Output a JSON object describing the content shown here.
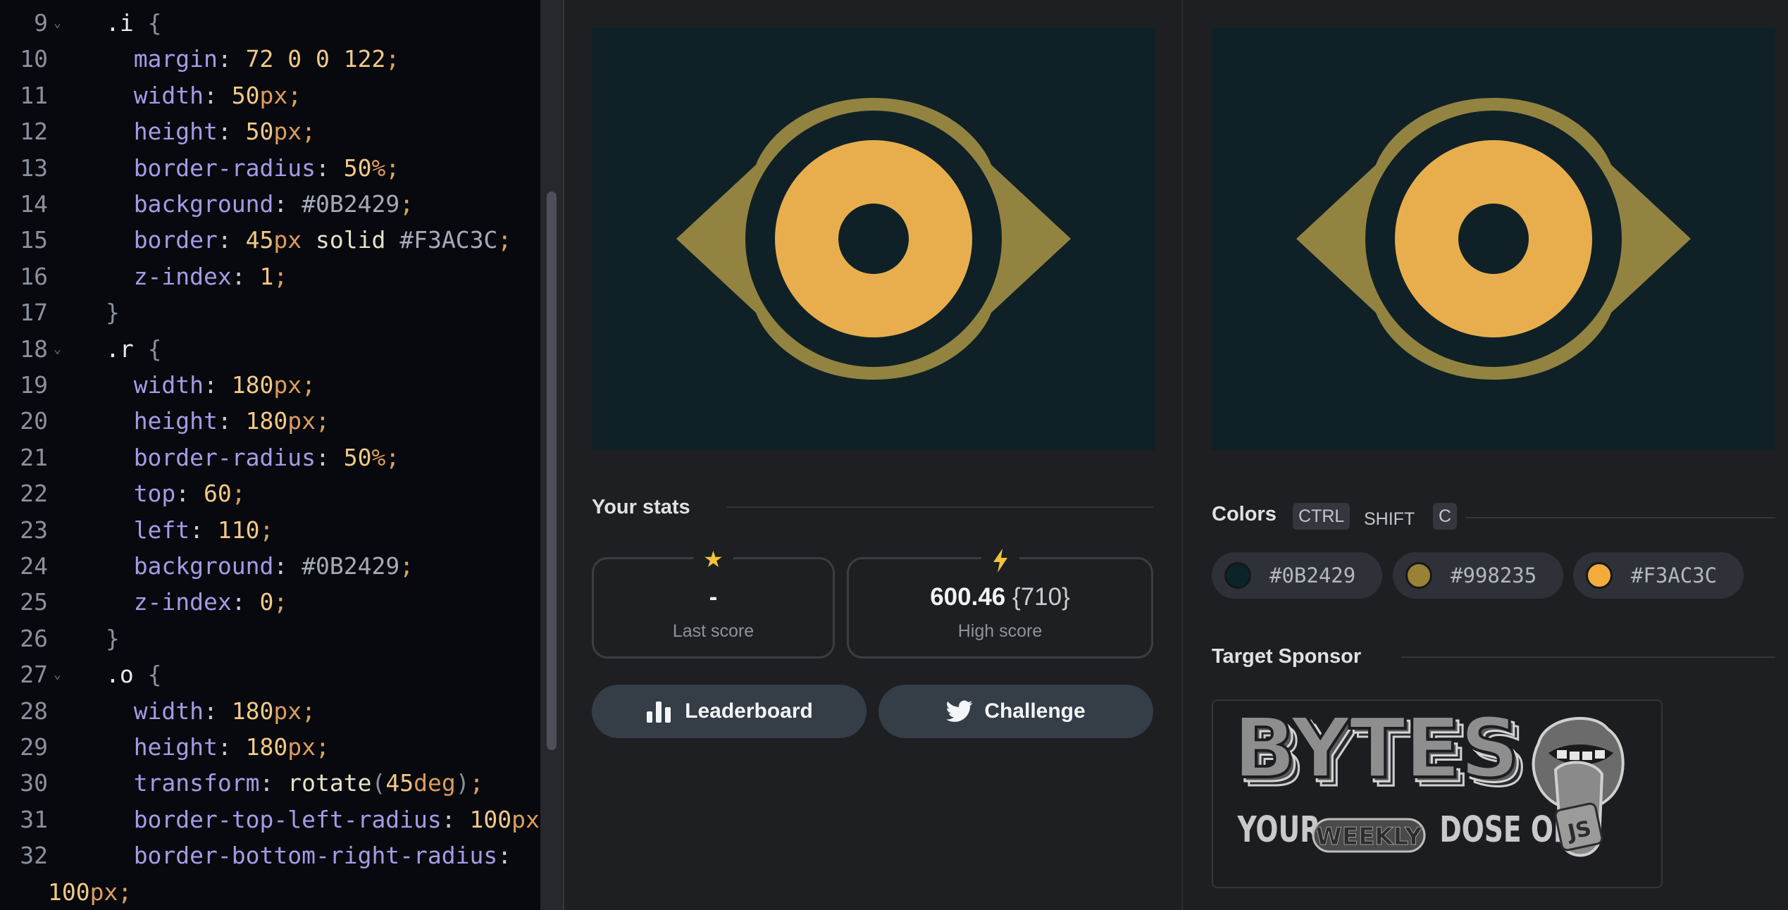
{
  "editor": {
    "lines": [
      {
        "num": "9",
        "fold": true,
        "indent": "  ",
        "tokens": [
          [
            ".i",
            "sel"
          ],
          [
            " ",
            ""
          ],
          [
            "{",
            "brace"
          ]
        ]
      },
      {
        "num": "10",
        "fold": false,
        "indent": "    ",
        "tokens": [
          [
            "margin",
            "prop"
          ],
          [
            ": ",
            ""
          ],
          [
            "72 0 0 122",
            "num"
          ],
          [
            ";",
            "punc"
          ]
        ]
      },
      {
        "num": "11",
        "fold": false,
        "indent": "    ",
        "tokens": [
          [
            "width",
            "prop"
          ],
          [
            ": ",
            ""
          ],
          [
            "50",
            "num"
          ],
          [
            "px",
            "unit"
          ],
          [
            ";",
            "punc"
          ]
        ]
      },
      {
        "num": "12",
        "fold": false,
        "indent": "    ",
        "tokens": [
          [
            "height",
            "prop"
          ],
          [
            ": ",
            ""
          ],
          [
            "50",
            "num"
          ],
          [
            "px",
            "unit"
          ],
          [
            ";",
            "punc"
          ]
        ]
      },
      {
        "num": "13",
        "fold": false,
        "indent": "    ",
        "tokens": [
          [
            "border-radius",
            "prop"
          ],
          [
            ": ",
            ""
          ],
          [
            "50",
            "num"
          ],
          [
            "%",
            "unit"
          ],
          [
            ";",
            "punc"
          ]
        ]
      },
      {
        "num": "14",
        "fold": false,
        "indent": "    ",
        "tokens": [
          [
            "background",
            "prop"
          ],
          [
            ": ",
            ""
          ],
          [
            "#0B2429",
            "hex"
          ],
          [
            ";",
            "punc"
          ]
        ]
      },
      {
        "num": "15",
        "fold": false,
        "indent": "    ",
        "tokens": [
          [
            "border",
            "prop"
          ],
          [
            ": ",
            ""
          ],
          [
            "45",
            "num"
          ],
          [
            "px",
            "unit"
          ],
          [
            " ",
            ""
          ],
          [
            "solid",
            "kw"
          ],
          [
            " ",
            ""
          ],
          [
            "#F3AC3C",
            "hex"
          ],
          [
            ";",
            "punc"
          ]
        ]
      },
      {
        "num": "16",
        "fold": false,
        "indent": "    ",
        "tokens": [
          [
            "z-index",
            "prop"
          ],
          [
            ": ",
            ""
          ],
          [
            "1",
            "num"
          ],
          [
            ";",
            "punc"
          ]
        ]
      },
      {
        "num": "17",
        "fold": false,
        "indent": "  ",
        "tokens": [
          [
            "}",
            "brace"
          ]
        ]
      },
      {
        "num": "18",
        "fold": true,
        "indent": "  ",
        "tokens": [
          [
            ".r",
            "sel"
          ],
          [
            " ",
            ""
          ],
          [
            "{",
            "brace"
          ]
        ]
      },
      {
        "num": "19",
        "fold": false,
        "indent": "    ",
        "tokens": [
          [
            "width",
            "prop"
          ],
          [
            ": ",
            ""
          ],
          [
            "180",
            "num"
          ],
          [
            "px",
            "unit"
          ],
          [
            ";",
            "punc"
          ]
        ]
      },
      {
        "num": "20",
        "fold": false,
        "indent": "    ",
        "tokens": [
          [
            "height",
            "prop"
          ],
          [
            ": ",
            ""
          ],
          [
            "180",
            "num"
          ],
          [
            "px",
            "unit"
          ],
          [
            ";",
            "punc"
          ]
        ]
      },
      {
        "num": "21",
        "fold": false,
        "indent": "    ",
        "tokens": [
          [
            "border-radius",
            "prop"
          ],
          [
            ": ",
            ""
          ],
          [
            "50",
            "num"
          ],
          [
            "%",
            "unit"
          ],
          [
            ";",
            "punc"
          ]
        ]
      },
      {
        "num": "22",
        "fold": false,
        "indent": "    ",
        "tokens": [
          [
            "top",
            "prop"
          ],
          [
            ": ",
            ""
          ],
          [
            "60",
            "num"
          ],
          [
            ";",
            "punc"
          ]
        ]
      },
      {
        "num": "23",
        "fold": false,
        "indent": "    ",
        "tokens": [
          [
            "left",
            "prop"
          ],
          [
            ": ",
            ""
          ],
          [
            "110",
            "num"
          ],
          [
            ";",
            "punc"
          ]
        ]
      },
      {
        "num": "24",
        "fold": false,
        "indent": "    ",
        "tokens": [
          [
            "background",
            "prop"
          ],
          [
            ": ",
            ""
          ],
          [
            "#0B2429",
            "hex"
          ],
          [
            ";",
            "punc"
          ]
        ]
      },
      {
        "num": "25",
        "fold": false,
        "indent": "    ",
        "tokens": [
          [
            "z-index",
            "prop"
          ],
          [
            ": ",
            ""
          ],
          [
            "0",
            "num"
          ],
          [
            ";",
            "punc"
          ]
        ]
      },
      {
        "num": "26",
        "fold": false,
        "indent": "  ",
        "tokens": [
          [
            "}",
            "brace"
          ]
        ]
      },
      {
        "num": "27",
        "fold": true,
        "indent": "  ",
        "tokens": [
          [
            ".o",
            "sel"
          ],
          [
            " ",
            ""
          ],
          [
            "{",
            "brace"
          ]
        ]
      },
      {
        "num": "28",
        "fold": false,
        "indent": "    ",
        "tokens": [
          [
            "width",
            "prop"
          ],
          [
            ": ",
            ""
          ],
          [
            "180",
            "num"
          ],
          [
            "px",
            "unit"
          ],
          [
            ";",
            "punc"
          ]
        ]
      },
      {
        "num": "29",
        "fold": false,
        "indent": "    ",
        "tokens": [
          [
            "height",
            "prop"
          ],
          [
            ": ",
            ""
          ],
          [
            "180",
            "num"
          ],
          [
            "px",
            "unit"
          ],
          [
            ";",
            "punc"
          ]
        ]
      },
      {
        "num": "30",
        "fold": false,
        "indent": "    ",
        "tokens": [
          [
            "transform",
            "prop"
          ],
          [
            ": ",
            ""
          ],
          [
            "rotate",
            "kw"
          ],
          [
            "(",
            "brace"
          ],
          [
            "45",
            "num"
          ],
          [
            "deg",
            "unit"
          ],
          [
            ")",
            "brace"
          ],
          [
            ";",
            "punc"
          ]
        ]
      },
      {
        "num": "31",
        "fold": false,
        "indent": "    ",
        "tokens": [
          [
            "border-top-left-radius",
            "prop"
          ],
          [
            ": ",
            ""
          ],
          [
            "100",
            "num"
          ],
          [
            "px",
            "unit"
          ],
          [
            ";",
            "punc"
          ]
        ]
      },
      {
        "num": "32",
        "fold": false,
        "indent": "    ",
        "tokens": [
          [
            "border-bottom-right-radius",
            "prop"
          ],
          [
            ":",
            ""
          ]
        ]
      },
      {
        "num": "",
        "fold": false,
        "indent": "",
        "tokens": [
          [
            "100",
            "num"
          ],
          [
            "px",
            "unit"
          ],
          [
            ";",
            "punc"
          ]
        ]
      }
    ]
  },
  "stats": {
    "title": "Your stats",
    "last_score_value": "-",
    "last_score_label": "Last score",
    "high_score_value": "600.46",
    "high_score_sub": "{710}",
    "high_score_label": "High score"
  },
  "buttons": {
    "leaderboard": "Leaderboard",
    "challenge": "Challenge"
  },
  "colors": {
    "title": "Colors",
    "shortcut": [
      "CTRL",
      "SHIFT",
      "C"
    ],
    "swatches": [
      {
        "hex": "#0B2429",
        "label": "#0B2429"
      },
      {
        "hex": "#998235",
        "label": "#998235"
      },
      {
        "hex": "#F3AC3C",
        "label": "#F3AC3C"
      }
    ]
  },
  "target_colors": {
    "background": "#0F2127",
    "ring": "#938341",
    "iris": "#E8AE4E",
    "pupil": "#0F2127"
  },
  "sponsor": {
    "title": "Target Sponsor",
    "logo_word": "BYTES",
    "tagline_left": "YOUR",
    "tagline_badge": "WEEKLY",
    "tagline_right": "DOSE OF",
    "js_badge": "JS"
  }
}
